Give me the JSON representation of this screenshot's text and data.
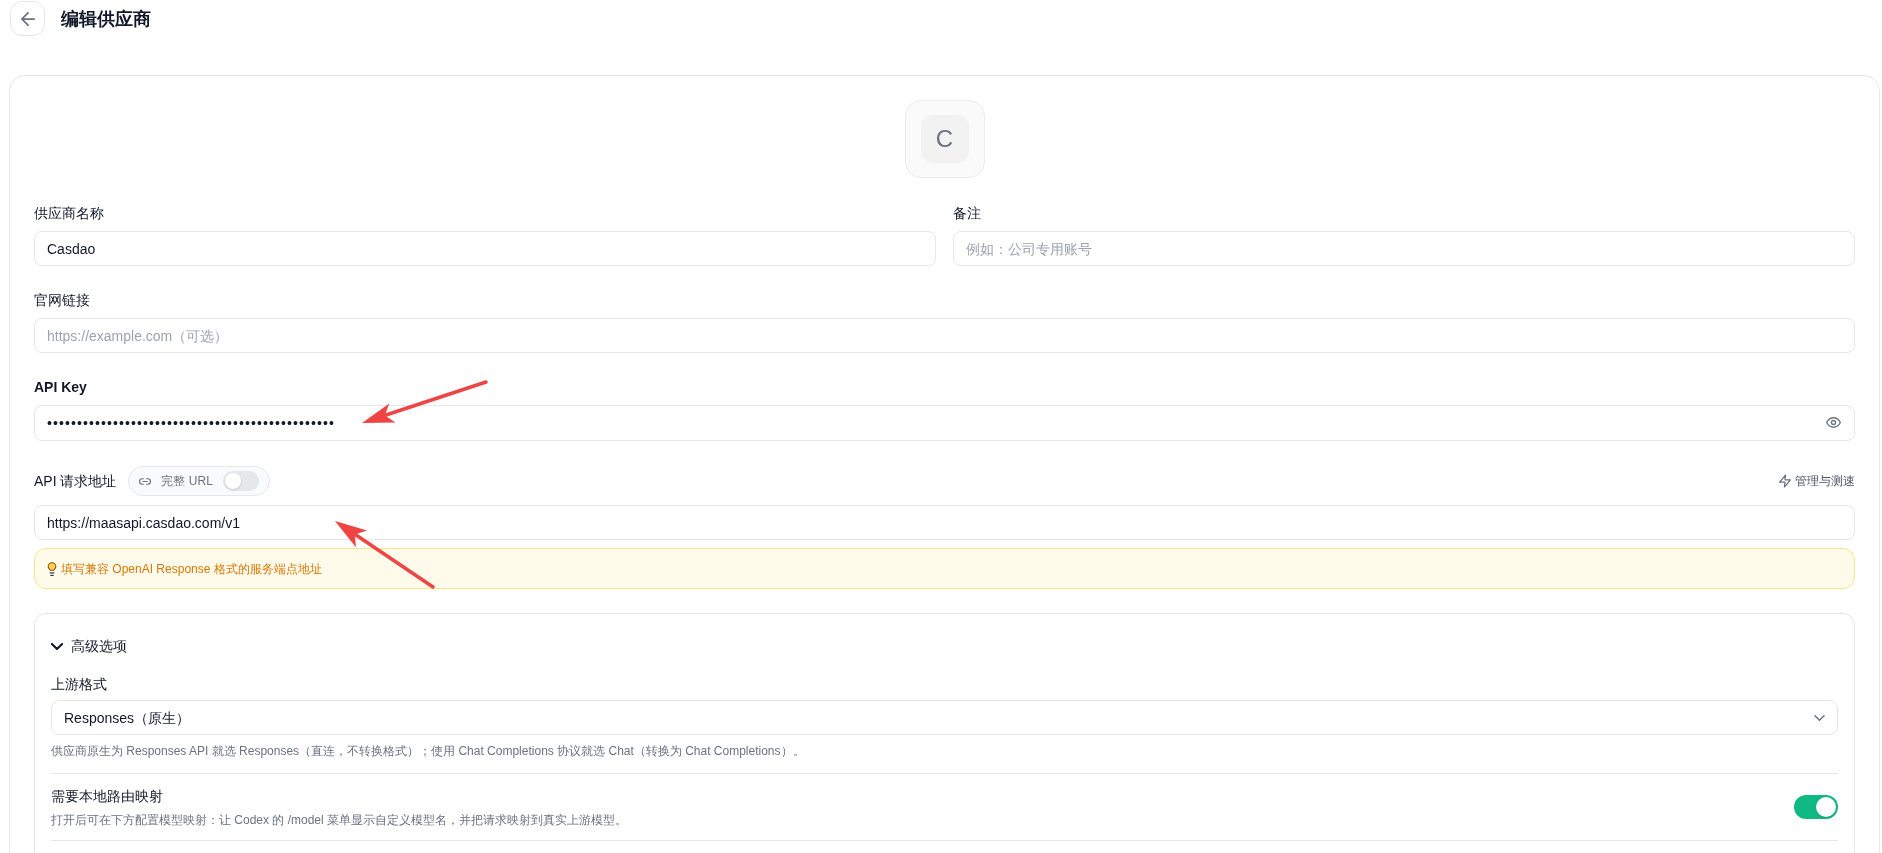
{
  "header": {
    "title": "编辑供应商"
  },
  "provider_avatar": {
    "letter": "C"
  },
  "form": {
    "name": {
      "label": "供应商名称",
      "value": "Casdao"
    },
    "note": {
      "label": "备注",
      "placeholder": "例如：公司专用账号"
    },
    "website": {
      "label": "官网链接",
      "placeholder": "https://example.com（可选）"
    },
    "api_key": {
      "label": "API Key",
      "value": "••••••••••••••••••••••••••••••••••••••••••••••••"
    },
    "base_url": {
      "label": "API 请求地址",
      "full_url_toggle": {
        "label": "完整 URL",
        "on": false
      },
      "action": "管理与测速",
      "value": "https://maasapi.casdao.com/v1",
      "hint": "填写兼容 OpenAI Response 格式的服务端点地址"
    }
  },
  "advanced": {
    "title": "高级选项",
    "expanded": true,
    "upstream_format": {
      "label": "上游格式",
      "value": "Responses（原生）",
      "help": "供应商原生为 Responses API 就选 Responses（直连，不转换格式）；使用 Chat Completions 协议就选 Chat（转换为 Chat Completions）。"
    },
    "route_mapping": {
      "label": "需要本地路由映射",
      "description": "打开后可在下方配置模型映射：让 Codex 的 /model 菜单显示自定义模型名，并把请求映射到真实上游模型。",
      "on": true
    }
  }
}
